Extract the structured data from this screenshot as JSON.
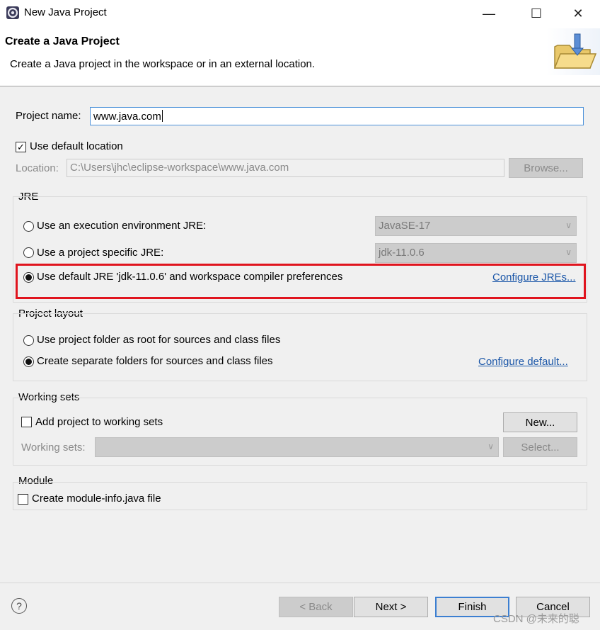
{
  "window": {
    "title": "New Java Project",
    "controls": {
      "minimize": "—",
      "maximize": "☐",
      "close": "✕"
    }
  },
  "header": {
    "title": "Create a Java Project",
    "description": "Create a Java project in the workspace or in an external location.",
    "icon": "new-folder-wizard-icon"
  },
  "project": {
    "name_label": "Project name:",
    "name_value": "www.java.com",
    "use_default_location_label": "Use default location",
    "use_default_location_checked": true,
    "location_label": "Location:",
    "location_value": "C:\\Users\\jhc\\eclipse-workspace\\www.java.com",
    "browse_label": "Browse..."
  },
  "jre": {
    "group_label": "JRE",
    "option_exec_env": "Use an execution environment JRE:",
    "exec_env_value": "JavaSE-17",
    "option_specific": "Use a project specific JRE:",
    "specific_value": "jdk-11.0.6",
    "option_default": "Use default JRE 'jdk-11.0.6' and workspace compiler preferences",
    "selected": "default",
    "configure_link": "Configure JREs..."
  },
  "layout": {
    "group_label": "Project layout",
    "option_root": "Use project folder as root for sources and class files",
    "option_separate": "Create separate folders for sources and class files",
    "selected": "separate",
    "configure_link": "Configure default..."
  },
  "working_sets": {
    "group_label": "Working sets",
    "add_label": "Add project to working sets",
    "add_checked": false,
    "new_button": "New...",
    "sets_label": "Working sets:",
    "sets_value": "",
    "select_button": "Select..."
  },
  "module": {
    "group_label": "Module",
    "create_label": "Create module-info.java file",
    "create_checked": false
  },
  "footer": {
    "help_symbol": "?",
    "back_button": "< Back",
    "next_button": "Next >",
    "finish_button": "Finish",
    "cancel_button": "Cancel"
  },
  "watermark": "CSDN @未来的聪",
  "colors": {
    "highlight": "#e0141e",
    "link": "#1a56a8",
    "default_button_border": "#3c7fd1"
  }
}
